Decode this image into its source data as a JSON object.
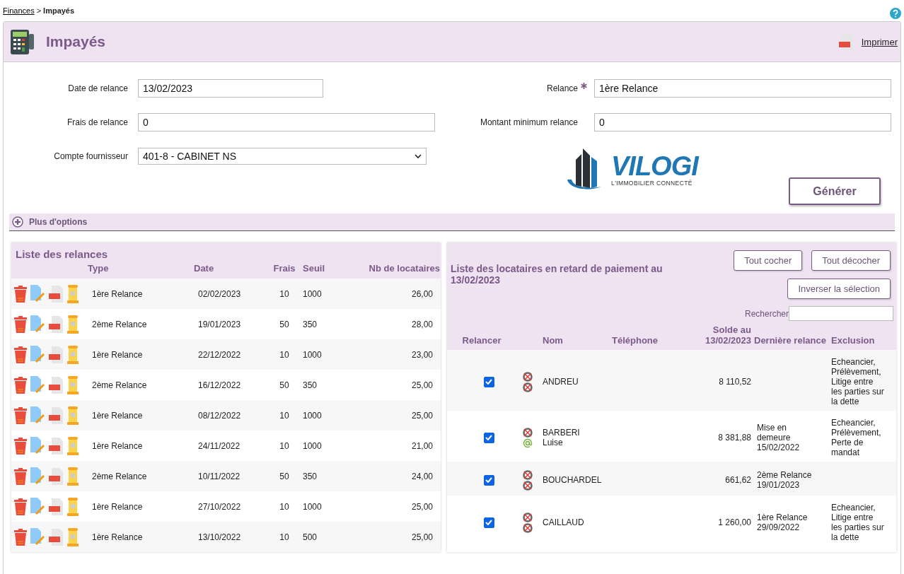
{
  "breadcrumb": {
    "parent": "Finances",
    "separator": ">",
    "current": "Impayés"
  },
  "page": {
    "title": "Impayés",
    "print": "Imprimer"
  },
  "form": {
    "left": [
      {
        "label": "Date de relance",
        "value": "13/02/2023",
        "kind": "date"
      },
      {
        "label": "Frais de relance",
        "value": "0",
        "kind": "text"
      },
      {
        "label": "Compte fournisseur",
        "value": "401-8 - CABINET NS",
        "kind": "select"
      }
    ],
    "right": [
      {
        "label": "Relance",
        "value": "1ère Relance",
        "required": true
      },
      {
        "label": "Montant minimum relance",
        "value": "0",
        "required": false
      }
    ],
    "logo": {
      "name": "VILOGI",
      "tagline": "L'IMMOBILIER CONNECTÉ"
    },
    "generate": "Générer"
  },
  "options": {
    "label": "Plus d'options",
    "expanded": false
  },
  "relances": {
    "title": "Liste des relances",
    "columns": [
      "Type",
      "Date",
      "Frais",
      "Seuil",
      "Nb de locataires"
    ],
    "rows": [
      {
        "type": "1ère Relance",
        "date": "02/02/2023",
        "frais": "10",
        "seuil": "1000",
        "count": "26,00"
      },
      {
        "type": "2ème Relance",
        "date": "19/01/2023",
        "frais": "50",
        "seuil": "350",
        "count": "28,00"
      },
      {
        "type": "1ère Relance",
        "date": "22/12/2022",
        "frais": "10",
        "seuil": "1000",
        "count": "23,00"
      },
      {
        "type": "2ème Relance",
        "date": "16/12/2022",
        "frais": "50",
        "seuil": "350",
        "count": "25,00"
      },
      {
        "type": "1ère Relance",
        "date": "08/12/2022",
        "frais": "10",
        "seuil": "1000",
        "count": "25,00"
      },
      {
        "type": "1ère Relance",
        "date": "24/11/2022",
        "frais": "10",
        "seuil": "1000",
        "count": "21,00"
      },
      {
        "type": "2ème Relance",
        "date": "10/11/2022",
        "frais": "50",
        "seuil": "350",
        "count": "24,00"
      },
      {
        "type": "1ère Relance",
        "date": "27/10/2022",
        "frais": "10",
        "seuil": "1000",
        "count": "25,00"
      },
      {
        "type": "1ère Relance",
        "date": "13/10/2022",
        "frais": "10",
        "seuil": "500",
        "count": "25,00"
      }
    ]
  },
  "locataires": {
    "title": "Liste des locataires en retard de paiement au 13/02/2023",
    "buttons": [
      "Tout cocher",
      "Tout décocher",
      "Inverser la sélection"
    ],
    "search_label": "Rechercher",
    "columns": [
      "Relancer",
      "Nom",
      "Téléphone",
      "Solde au 13/02/2023",
      "Dernière relance",
      "Exclusion"
    ],
    "rows": [
      {
        "checked": true,
        "contacts": [
          {
            "kind": "none"
          },
          {
            "kind": "none"
          }
        ],
        "name": [
          "ANDREU"
        ],
        "solde": "8 110,52",
        "exclusion": "Echeancier, Prélèvement, Litige entre les parties sur la dette"
      },
      {
        "checked": true,
        "contacts": [
          {
            "kind": "none"
          },
          {
            "kind": "email"
          }
        ],
        "name": [
          "BARBERI",
          "Luise"
        ],
        "solde": "8 381,88",
        "last": [
          "Mise en",
          "demeure",
          "15/02/2022"
        ],
        "exclusion": "Echeancier, Prélèvement, Perte de mandat"
      },
      {
        "checked": true,
        "contacts": [
          {
            "kind": "none"
          },
          {
            "kind": "none"
          }
        ],
        "name": [
          "BOUCHARDEL"
        ],
        "solde": "661,62",
        "last": [
          "2ème Relance",
          "19/01/2023"
        ]
      },
      {
        "checked": true,
        "contacts": [
          {
            "kind": "none"
          },
          {
            "kind": "none"
          }
        ],
        "name": [
          "CAILLAUD"
        ],
        "solde": "1 260,00",
        "last": [
          "1ère Relance",
          "29/09/2022"
        ],
        "exclusion": "Echeancier, Litige entre les parties sur la dette"
      }
    ]
  }
}
